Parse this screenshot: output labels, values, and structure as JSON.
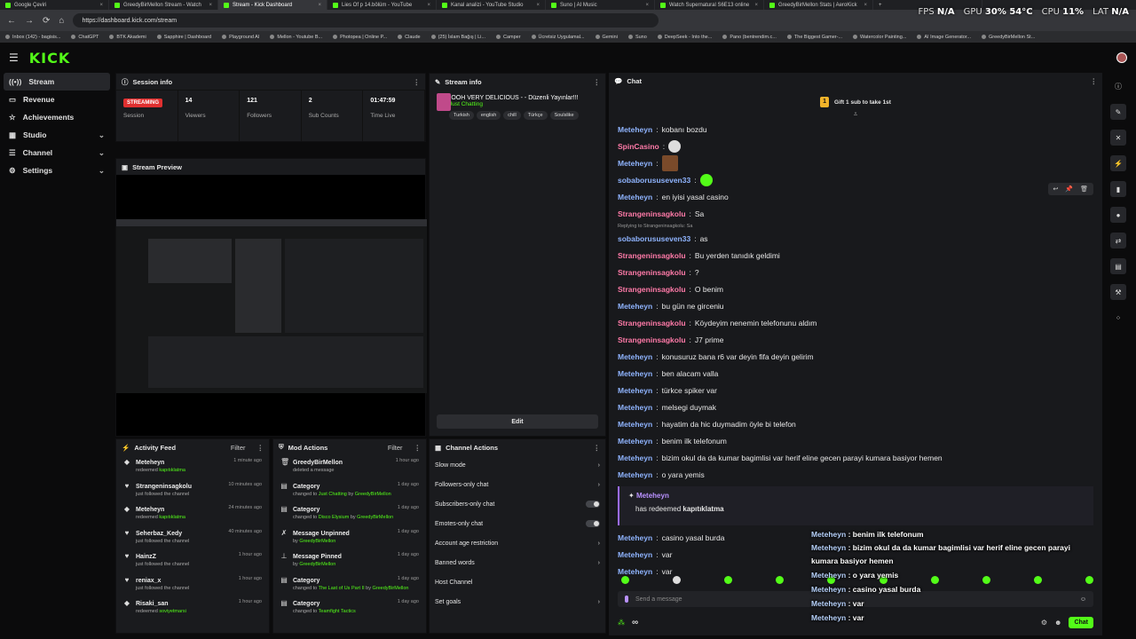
{
  "browser": {
    "tabs": [
      "Google Çeviri",
      "GreedyBirMellon Stream - Watch",
      "Stream - Kick Dashboard",
      "Lies Of p 14.bölüm - YouTube",
      "Kanal analizi - YouTube Studio",
      "Suno | AI Music",
      "Watch Supernatural S6E13 online",
      "GreedyBirMellon Stats | AeroKick"
    ],
    "url": "https://dashboard.kick.com/stream",
    "bookmarks": [
      "Inbox (142) - bagisis...",
      "ChatGPT",
      "BTK Akademi",
      "Sapphire | Dashboard",
      "Playground AI",
      "Mellon - Youtube B...",
      "Photopea | Online P...",
      "Claude",
      "(25) İslam Bağış | Li...",
      "Camper",
      "Ücretsiz Uygulamal...",
      "Gemini",
      "Suno",
      "DeepSeek - Into the...",
      "Pano (bentrendim.c...",
      "The Biggest Gamer-...",
      "Watercolor Painting...",
      "AI Image Generator...",
      "GreedyBirMellon St..."
    ]
  },
  "overlay": {
    "fps_label": "FPS",
    "fps": "N/A",
    "gpu_label": "GPU",
    "gpu": "30%  54°C",
    "cpu_label": "CPU",
    "cpu": "11%",
    "lat_label": "LAT",
    "lat": "N/A"
  },
  "brand": {
    "logo": "KICK",
    "accent": "#53fc18"
  },
  "sidebar": [
    {
      "label": "Stream"
    },
    {
      "label": "Revenue"
    },
    {
      "label": "Achievements"
    },
    {
      "label": "Studio"
    },
    {
      "label": "Channel"
    },
    {
      "label": "Settings"
    }
  ],
  "session": {
    "title": "Session info",
    "badge": "STREAMING",
    "stats": [
      {
        "value": "",
        "label": "Session"
      },
      {
        "value": "14",
        "label": "Viewers"
      },
      {
        "value": "121",
        "label": "Followers"
      },
      {
        "value": "2",
        "label": "Sub Counts"
      },
      {
        "value": "01:47:59",
        "label": "Time Live"
      }
    ]
  },
  "preview": {
    "title": "Stream Preview"
  },
  "streaminfo": {
    "title": "Stream info",
    "stream_title": "OOOOOH VERY DELICIOUS - - Düzenli Yayınlar!!!",
    "category": "Just Chatting",
    "tags": [
      "Turkish",
      "english",
      "chill",
      "Türkçe",
      "Soulslike"
    ],
    "edit": "Edit"
  },
  "activity": {
    "title": "Activity Feed",
    "filter": "Filter",
    "items": [
      {
        "name": "Meteheyn",
        "sub": "redeemed",
        "item": "kapıtıklatma",
        "time": "1 minute ago"
      },
      {
        "name": "Strangeninsagkolu",
        "sub": "just followed the channel",
        "item": "",
        "time": "10 minutes ago"
      },
      {
        "name": "Meteheyn",
        "sub": "redeemed",
        "item": "kapıtıklatma",
        "time": "24 minutes ago"
      },
      {
        "name": "Seherbaz_Kedy",
        "sub": "just followed the channel",
        "item": "",
        "time": "40 minutes ago"
      },
      {
        "name": "HainzZ",
        "sub": "just followed the channel",
        "item": "",
        "time": "1 hour ago"
      },
      {
        "name": "reniax_x",
        "sub": "just followed the channel",
        "item": "",
        "time": "1 hour ago"
      },
      {
        "name": "Risaki_san",
        "sub": "redeemed",
        "item": "soviyetmarsi",
        "time": "1 hour ago"
      }
    ]
  },
  "mod": {
    "title": "Mod Actions",
    "filter": "Filter",
    "items": [
      {
        "name": "GreedyBirMellon",
        "sub": "deleted a message",
        "item": "",
        "time": "1 hour ago"
      },
      {
        "name": "Category",
        "sub": "changed to",
        "item": "Just Chatting",
        "by": "GreedyBirMellon",
        "time": "1 day ago"
      },
      {
        "name": "Category",
        "sub": "changed to",
        "item": "Disco Elysium",
        "by": "GreedyBirMellon",
        "time": "1 day ago"
      },
      {
        "name": "Message Unpinned",
        "sub": "",
        "item": "",
        "by": "GreedyBirMellon",
        "time": "1 day ago"
      },
      {
        "name": "Message Pinned",
        "sub": "",
        "item": "",
        "by": "GreedyBirMellon",
        "time": "1 day ago"
      },
      {
        "name": "Category",
        "sub": "changed to",
        "item": "The Last of Us Part II",
        "by": "GreedyBirMellon",
        "time": "1 day ago"
      },
      {
        "name": "Category",
        "sub": "changed to",
        "item": "Teamfight Tactics",
        "by": "",
        "time": "1 day ago"
      }
    ],
    "by_word": "by"
  },
  "channel": {
    "title": "Channel Actions",
    "items": [
      "Slow mode",
      "Followers-only chat",
      "Subscribers-only chat",
      "Emotes-only chat",
      "Account age restriction",
      "Banned words",
      "Host Channel",
      "Set goals"
    ]
  },
  "chat": {
    "title": "Chat",
    "gift": "Gift 1 sub to take 1st",
    "coin": "1",
    "messages": [
      {
        "u": "Meteheyn",
        "c": "b",
        "t": "kobanı bozdu"
      },
      {
        "u": "SpinCasino",
        "c": "p",
        "t": "",
        "emote": "w"
      },
      {
        "u": "Meteheyn",
        "c": "b",
        "t": "",
        "emote": "face"
      },
      {
        "u": "sobaborususeven33",
        "c": "b",
        "t": "",
        "emote": "g"
      },
      {
        "u": "Meteheyn",
        "c": "b",
        "t": "en iyisi yasal casino"
      },
      {
        "u": "Strangeninsagkolu",
        "c": "p",
        "t": "Sa"
      },
      {
        "reply": "Replying to Strangeninsagkolu: Sa"
      },
      {
        "u": "sobaborususeven33",
        "c": "b",
        "t": "as"
      },
      {
        "u": "Strangeninsagkolu",
        "c": "p",
        "t": "Bu yerden tanıdık geldimi"
      },
      {
        "u": "Strangeninsagkolu",
        "c": "p",
        "t": "?"
      },
      {
        "u": "Strangeninsagkolu",
        "c": "p",
        "t": "O benim"
      },
      {
        "u": "Meteheyn",
        "c": "b",
        "t": "bu gün ne girceniu"
      },
      {
        "u": "Strangeninsagkolu",
        "c": "p",
        "t": "Köydeyim nenemin telefonunu aldım"
      },
      {
        "u": "Strangeninsagkolu",
        "c": "p",
        "t": "J7 prime"
      },
      {
        "u": "Meteheyn",
        "c": "b",
        "t": "konusuruz bana r6 var deyin fifa deyin gelirim"
      },
      {
        "u": "Meteheyn",
        "c": "b",
        "t": "ben alacam valla"
      },
      {
        "u": "Meteheyn",
        "c": "b",
        "t": "türkce spiker var"
      },
      {
        "u": "Meteheyn",
        "c": "b",
        "t": "melsegi duymak"
      },
      {
        "u": "Meteheyn",
        "c": "b",
        "t": "hayatim da hic duymadim öyle bi telefon"
      },
      {
        "u": "Meteheyn",
        "c": "b",
        "t": "benim ilk telefonum"
      },
      {
        "u": "Meteheyn",
        "c": "b",
        "t": "bizim okul da da kumar bagimlisi var herif eline gecen parayi kumara basiyor hemen"
      },
      {
        "u": "Meteheyn",
        "c": "b",
        "t": "o yara yemis"
      },
      {
        "redeem": true,
        "u": "Meteheyn",
        "t": "has redeemed",
        "item": "kapıtıklatma"
      },
      {
        "u": "Meteheyn",
        "c": "b",
        "t": "casino yasal burda"
      },
      {
        "u": "Meteheyn",
        "c": "b",
        "t": "var"
      },
      {
        "u": "Meteheyn",
        "c": "b",
        "t": "var"
      }
    ],
    "placeholder": "Send a message",
    "send": "Chat",
    "infinity": "∞"
  },
  "overlay_chat": [
    {
      "u": "Meteheyn",
      "t": "benim ilk telefonum"
    },
    {
      "u": "Meteheyn",
      "t": "bizim okul da da kumar bagimlisi var herif eline gecen parayi kumara basiyor hemen"
    },
    {
      "u": "Meteheyn",
      "t": "o yara yemis"
    },
    {
      "u": "Meteheyn",
      "t": "casino yasal burda"
    },
    {
      "u": "Meteheyn",
      "t": "var"
    },
    {
      "u": "Meteheyn",
      "t": "var"
    }
  ]
}
